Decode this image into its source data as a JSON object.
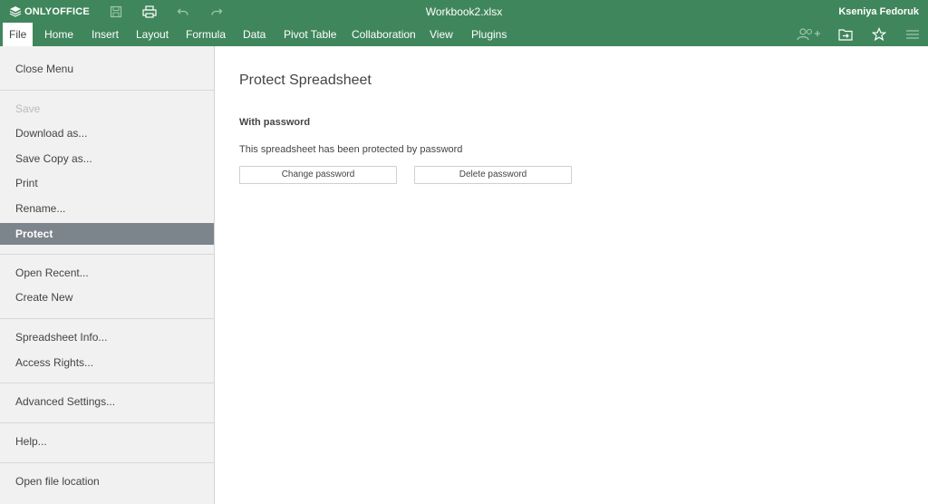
{
  "titlebar": {
    "logo_text": "ONLYOFFICE",
    "document_title": "Workbook2.xlsx",
    "user_name": "Kseniya Fedoruk",
    "quick_access": [
      "save-icon",
      "print-icon",
      "undo-icon",
      "redo-icon"
    ],
    "bar_color": "#40865c"
  },
  "tabs": [
    {
      "label": "File",
      "active": true
    },
    {
      "label": "Home"
    },
    {
      "label": "Insert"
    },
    {
      "label": "Layout"
    },
    {
      "label": "Formula"
    },
    {
      "label": "Data"
    },
    {
      "label": "Pivot Table"
    },
    {
      "label": "Collaboration"
    },
    {
      "label": "View"
    },
    {
      "label": "Plugins"
    }
  ],
  "tab_icons": [
    "add-user-icon",
    "open-location-icon",
    "favorite-star-icon",
    "hamburger-menu-icon"
  ],
  "file_menu": {
    "items": [
      {
        "label": "Close Menu"
      },
      {
        "label": "Save",
        "disabled": true
      },
      {
        "label": "Download as..."
      },
      {
        "label": "Save Copy as..."
      },
      {
        "label": "Print"
      },
      {
        "label": "Rename..."
      },
      {
        "label": "Protect",
        "active": true
      },
      {
        "label": "Open Recent..."
      },
      {
        "label": "Create New"
      },
      {
        "label": "Spreadsheet Info..."
      },
      {
        "label": "Access Rights..."
      },
      {
        "label": "Advanced Settings..."
      },
      {
        "label": "Help..."
      },
      {
        "label": "Open file location"
      }
    ],
    "active_color": "#7d858c"
  },
  "panel": {
    "title": "Protect Spreadsheet",
    "section_title": "With password",
    "description": "This spreadsheet has been protected by password",
    "change_button": "Change password",
    "delete_button": "Delete password"
  }
}
